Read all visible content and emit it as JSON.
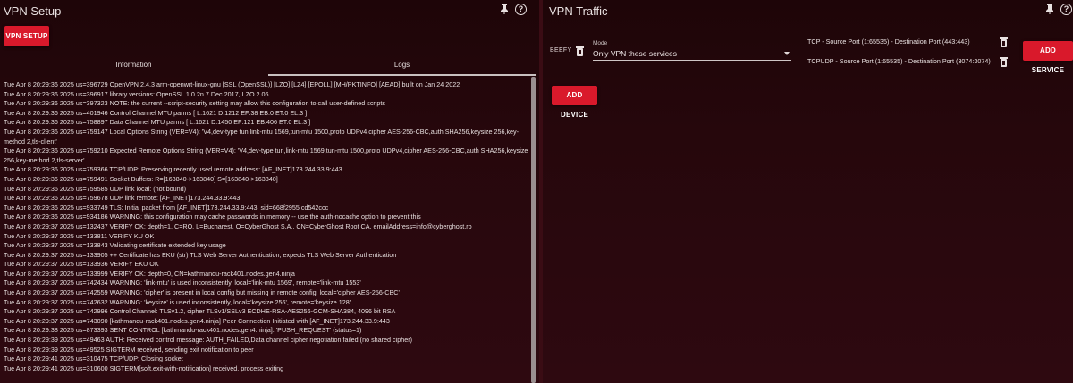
{
  "left": {
    "title": "VPN Setup",
    "setup_button": "VPN SETUP",
    "tabs": [
      "Information",
      "Logs"
    ],
    "active_tab": "Logs",
    "log_lines": [
      "Tue Apr  8 20:29:36 2025 us=396729 OpenVPN 2.4.3 arm-openwrt-linux-gnu [SSL (OpenSSL)] [LZO] [LZ4] [EPOLL] [MH/PKTINFO] [AEAD] built on Jan 24 2022",
      "Tue Apr  8 20:29:36 2025 us=396917 library versions: OpenSSL 1.0.2n  7 Dec 2017, LZO 2.06",
      "Tue Apr  8 20:29:36 2025 us=397323 NOTE: the current --script-security setting may allow this configuration to call user-defined scripts",
      "Tue Apr  8 20:29:36 2025 us=401946 Control Channel MTU parms [ L:1621 D:1212 EF:38 EB:0 ET:0 EL:3 ]",
      "Tue Apr  8 20:29:36 2025 us=758897 Data Channel MTU parms [ L:1621 D:1450 EF:121 EB:406 ET:0 EL:3 ]",
      "Tue Apr  8 20:29:36 2025 us=759147 Local Options String (VER=V4): 'V4,dev-type tun,link-mtu 1569,tun-mtu 1500,proto UDPv4,cipher AES-256-CBC,auth SHA256,keysize 256,key-method 2,tls-client'",
      "Tue Apr  8 20:29:36 2025 us=759210 Expected Remote Options String (VER=V4): 'V4,dev-type tun,link-mtu 1569,tun-mtu 1500,proto UDPv4,cipher AES-256-CBC,auth SHA256,keysize 256,key-method 2,tls-server'",
      "Tue Apr  8 20:29:36 2025 us=759366 TCP/UDP: Preserving recently used remote address: [AF_INET]173.244.33.9:443",
      "Tue Apr  8 20:29:36 2025 us=759491 Socket Buffers: R=[163840->163840] S=[163840->163840]",
      "Tue Apr  8 20:29:36 2025 us=759585 UDP link local: (not bound)",
      "Tue Apr  8 20:29:36 2025 us=759678 UDP link remote: [AF_INET]173.244.33.9:443",
      "Tue Apr  8 20:29:36 2025 us=933749 TLS: Initial packet from [AF_INET]173.244.33.9:443, sid=668f2955 cd542ccc",
      "Tue Apr  8 20:29:36 2025 us=934186 WARNING: this configuration may cache passwords in memory -- use the auth-nocache option to prevent this",
      "Tue Apr  8 20:29:37 2025 us=132437 VERIFY OK: depth=1, C=RO, L=Bucharest, O=CyberGhost S.A., CN=CyberGhost Root CA, emailAddress=info@cyberghost.ro",
      "Tue Apr  8 20:29:37 2025 us=133811 VERIFY KU OK",
      "Tue Apr  8 20:29:37 2025 us=133843 Validating certificate extended key usage",
      "Tue Apr  8 20:29:37 2025 us=133905 ++ Certificate has EKU (str) TLS Web Server Authentication, expects TLS Web Server Authentication",
      "Tue Apr  8 20:29:37 2025 us=133936 VERIFY EKU OK",
      "Tue Apr  8 20:29:37 2025 us=133999 VERIFY OK: depth=0, CN=kathmandu-rack401.nodes.gen4.ninja",
      "Tue Apr  8 20:29:37 2025 us=742434 WARNING: 'link-mtu' is used inconsistently, local='link-mtu 1569', remote='link-mtu 1553'",
      "Tue Apr  8 20:29:37 2025 us=742559 WARNING: 'cipher' is present in local config but missing in remote config, local='cipher AES-256-CBC'",
      "Tue Apr  8 20:29:37 2025 us=742632 WARNING: 'keysize' is used inconsistently, local='keysize 256', remote='keysize 128'",
      "Tue Apr  8 20:29:37 2025 us=742996 Control Channel: TLSv1.2, cipher TLSv1/SSLv3 ECDHE-RSA-AES256-GCM-SHA384, 4096 bit RSA",
      "Tue Apr  8 20:29:37 2025 us=743090 [kathmandu-rack401.nodes.gen4.ninja] Peer Connection Initiated with [AF_INET]173.244.33.9:443",
      "Tue Apr  8 20:29:38 2025 us=873393 SENT CONTROL [kathmandu-rack401.nodes.gen4.ninja]: 'PUSH_REQUEST' (status=1)",
      "Tue Apr  8 20:29:39 2025 us=49463 AUTH: Received control message: AUTH_FAILED,Data channel cipher negotiation failed (no shared cipher)",
      "Tue Apr  8 20:29:39 2025 us=49525 SIGTERM received, sending exit notification to peer",
      "Tue Apr  8 20:29:41 2025 us=310475 TCP/UDP: Closing socket",
      "Tue Apr  8 20:29:41 2025 us=310600 SIGTERM[soft,exit-with-notification] received, process exiting"
    ]
  },
  "right": {
    "title": "VPN Traffic",
    "device_tag": "BEEFY",
    "mode_label": "Mode",
    "mode_value": "Only VPN these services",
    "rules": [
      "TCP - Source Port (1:65535) - Destination Port (443:443)",
      "TCPUDP - Source Port (1:65535) - Destination Port (3074:3074)"
    ],
    "add_service_button": "ADD SERVICE",
    "add_device_button": "ADD DEVICE"
  },
  "icons": {
    "pin": "pin-icon",
    "help": "help-icon",
    "delete": "trash-icon",
    "dropdown": "chevron-down-icon"
  },
  "colors": {
    "accent": "#d9192b",
    "background": "#2a0a0e"
  }
}
